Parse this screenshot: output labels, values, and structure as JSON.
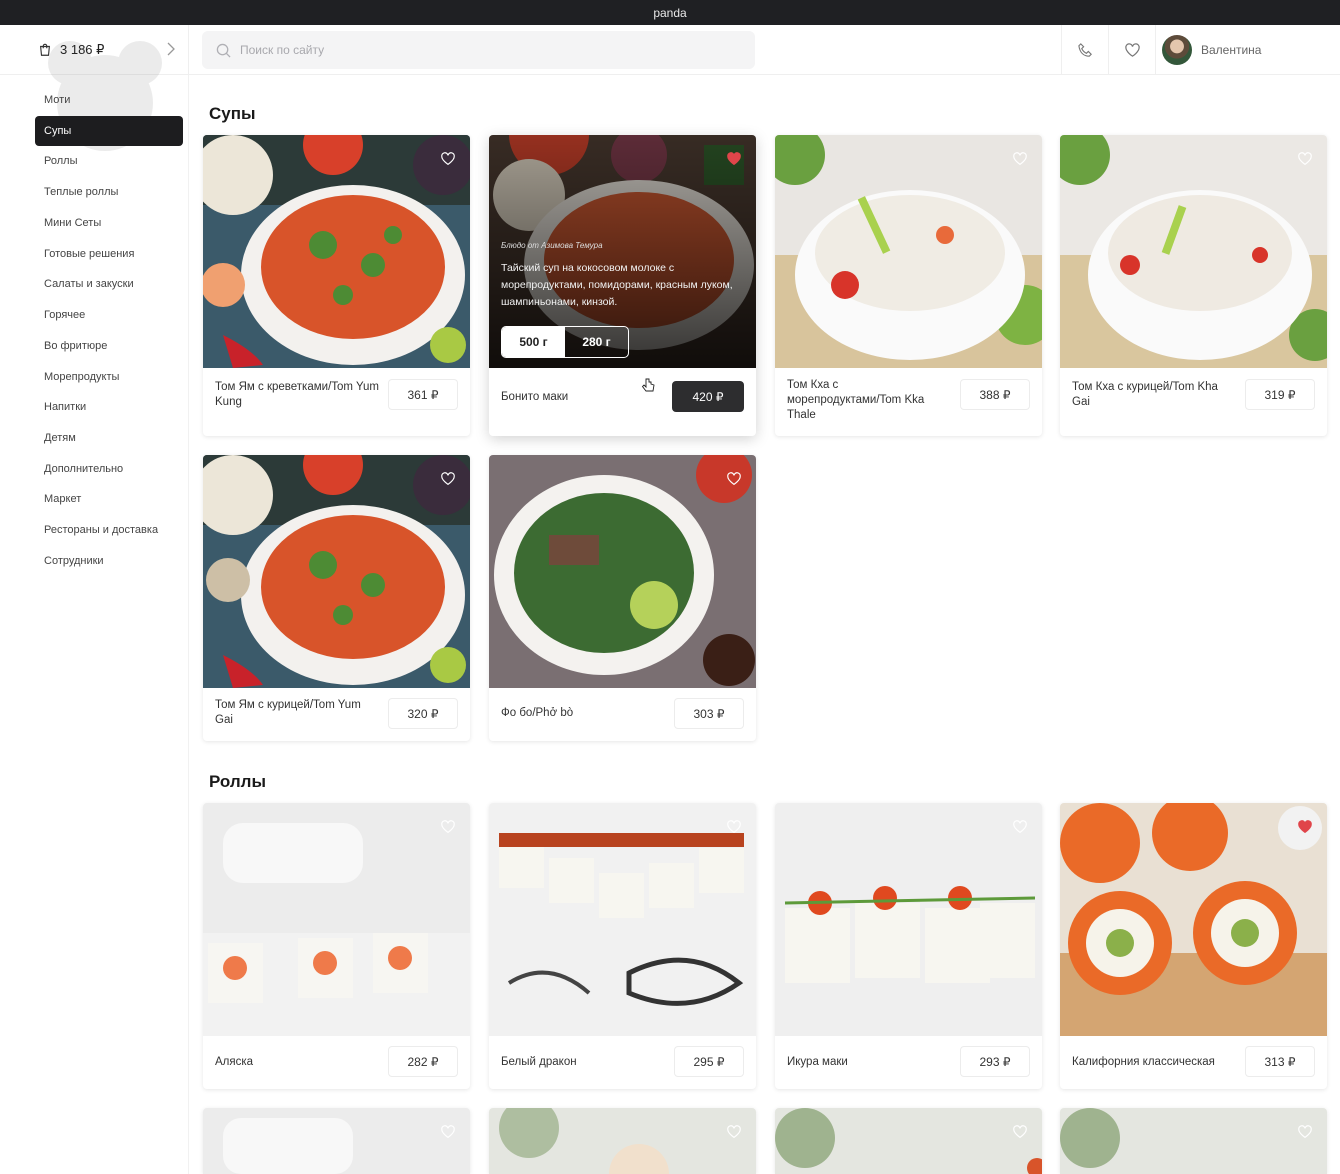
{
  "window": {
    "title": "panda"
  },
  "header": {
    "cart": {
      "total": "3 186 ₽",
      "icon": "cart-icon"
    },
    "search": {
      "placeholder": "Поиск по сайту"
    },
    "phone_icon": "phone-icon",
    "favorites_icon": "heart-icon",
    "user": {
      "name": "Валентина"
    }
  },
  "sidebar": {
    "items": [
      {
        "label": "Моти",
        "active": false
      },
      {
        "label": "Супы",
        "active": true
      },
      {
        "label": "Роллы",
        "active": false
      },
      {
        "label": "Теплые роллы",
        "active": false
      },
      {
        "label": "Мини Сеты",
        "active": false
      },
      {
        "label": "Готовые решения",
        "active": false
      },
      {
        "label": "Салаты и закуски",
        "active": false
      },
      {
        "label": "Горячее",
        "active": false
      },
      {
        "label": "Во фритюре",
        "active": false
      },
      {
        "label": "Морепродукты",
        "active": false
      },
      {
        "label": "Напитки",
        "active": false
      },
      {
        "label": "Детям",
        "active": false
      },
      {
        "label": "Дополнительно",
        "active": false
      },
      {
        "label": "Маркет",
        "active": false
      },
      {
        "label": "Рестораны и доставка",
        "active": false
      },
      {
        "label": "Сотрудники",
        "active": false
      }
    ]
  },
  "sections": [
    {
      "title": "Супы",
      "products": [
        {
          "name": "Том Ям с креветками/Tom Yum Kung",
          "price": "361 ₽",
          "favorite": false
        },
        {
          "name": "Бонито маки",
          "price": "420 ₽",
          "favorite": true,
          "hovered": true,
          "chef_note": "Блюдо от Азимова Темура",
          "description": "Тайский суп на кокосовом молоке с морепродуктами, помидорами, красным луком, шампиньонами, кинзой.",
          "weights": [
            "500 г",
            "280 г"
          ],
          "selected_weight": "500 г"
        },
        {
          "name": "Том Кха с морепродуктами/Tom Kka Thale",
          "price": "388 ₽",
          "favorite": false
        },
        {
          "name": "Том Кха с курицей/Tom Kha Gai",
          "price": "319 ₽",
          "favorite": false
        },
        {
          "name": "Том Ям с курицей/Tom Yum Gai",
          "price": "320 ₽",
          "favorite": false
        },
        {
          "name": "Фо бо/Phở bò",
          "price": "303 ₽",
          "favorite": false
        }
      ]
    },
    {
      "title": "Роллы",
      "products": [
        {
          "name": "Аляска",
          "price": "282 ₽",
          "favorite": false
        },
        {
          "name": "Белый дракон",
          "price": "295 ₽",
          "favorite": false
        },
        {
          "name": "Икура маки",
          "price": "293 ₽",
          "favorite": false
        },
        {
          "name": "Калифорния классическая",
          "price": "313 ₽",
          "favorite": true
        }
      ]
    }
  ],
  "colors": {
    "accent_dark": "#2d2d2f",
    "favorite_red": "#e0454a",
    "titlebar": "#1f2023"
  }
}
